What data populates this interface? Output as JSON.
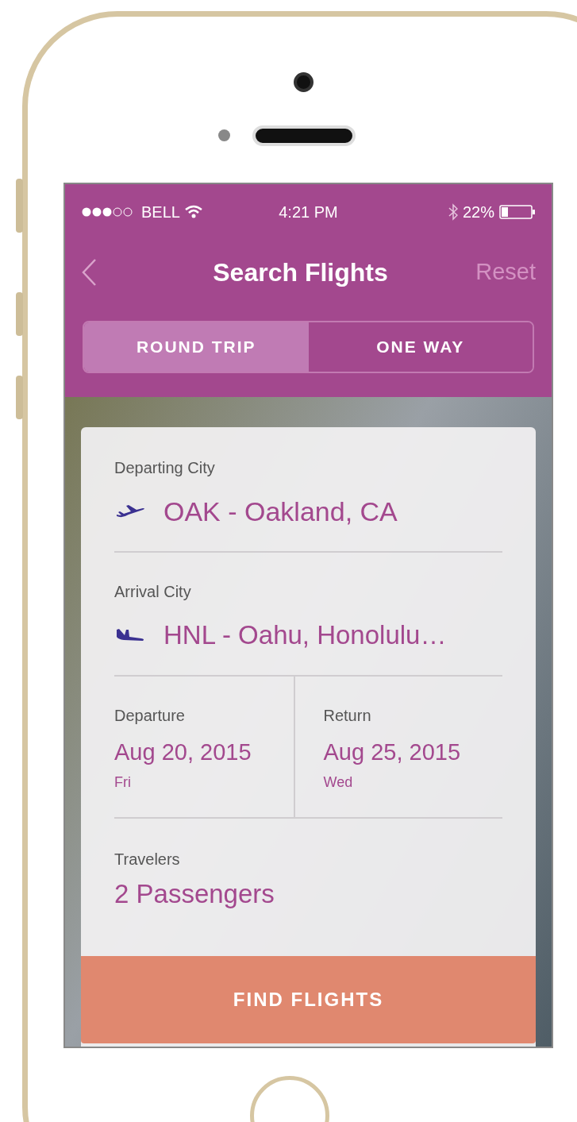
{
  "status_bar": {
    "carrier": "BELL",
    "time": "4:21 PM",
    "battery": "22%"
  },
  "nav": {
    "title": "Search Flights",
    "action": "Reset"
  },
  "trip_tabs": [
    {
      "label": "ROUND TRIP",
      "selected": true
    },
    {
      "label": "ONE WAY",
      "selected": false
    }
  ],
  "departing_city": {
    "label": "Departing City",
    "value": "OAK - Oakland, CA"
  },
  "arrival_city": {
    "label": "Arrival City",
    "value": "HNL - Oahu, Honolulu…"
  },
  "dates": [
    {
      "label": "Departure",
      "date": "Aug 20, 2015",
      "day": "Fri"
    },
    {
      "label": "Return",
      "date": "Aug 25, 2015",
      "day": "Wed"
    }
  ],
  "travelers": {
    "label": "Travelers",
    "value": "2 Passengers"
  },
  "submit": {
    "label": "FIND FLIGHTS"
  }
}
